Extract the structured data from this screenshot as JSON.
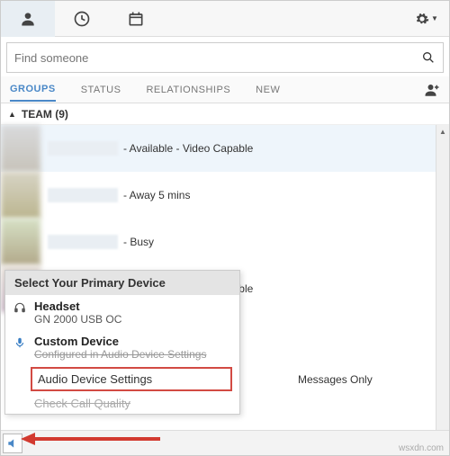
{
  "topbar": {
    "icons": {
      "contacts": "person-icon",
      "history": "clock-icon",
      "calendar": "calendar-icon",
      "settings": "gear-icon"
    }
  },
  "search": {
    "placeholder": "Find someone"
  },
  "tabs": {
    "items": [
      {
        "label": "GROUPS",
        "active": true
      },
      {
        "label": "STATUS",
        "active": false
      },
      {
        "label": "RELATIONSHIPS",
        "active": false
      },
      {
        "label": "NEW",
        "active": false
      }
    ],
    "add_contact": "add-contact-icon"
  },
  "group": {
    "name": "TEAM",
    "count": "(9)"
  },
  "contacts": [
    {
      "status": "- Available - Video Capable"
    },
    {
      "status": "- Away 5 mins"
    },
    {
      "status": "- Busy"
    },
    {
      "status": "- Available - Video Capable"
    }
  ],
  "popup": {
    "title": "Select Your Primary Device",
    "devices": [
      {
        "name": "Headset",
        "detail": "GN 2000 USB OC",
        "icon": "headset-icon"
      },
      {
        "name": "Custom Device",
        "detail": "Configured in Audio Device Settings",
        "icon": "mic-icon"
      }
    ],
    "links": {
      "audio_settings": "Audio Device Settings",
      "check_quality": "Check Call Quality"
    }
  },
  "messages_only": "Messages Only",
  "watermark": "wsxdn.com"
}
